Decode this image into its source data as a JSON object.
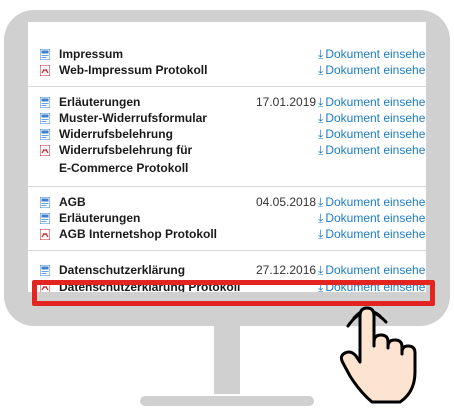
{
  "groups": [
    {
      "items": [
        {
          "icon": "web-doc-icon",
          "title": "Impressum",
          "date": "",
          "link": "Dokument einsehen"
        },
        {
          "icon": "pdf-icon",
          "title": "Web-Impressum Protokoll",
          "date": "",
          "link": "Dokument einsehen"
        }
      ]
    },
    {
      "items": [
        {
          "icon": "web-doc-icon",
          "title": "Erläuterungen",
          "date": "17.01.2019",
          "link": "Dokument einsehen"
        },
        {
          "icon": "web-doc-icon",
          "title": "Muster-Widerrufsformular",
          "date": "",
          "link": "Dokument einsehen"
        },
        {
          "icon": "web-doc-icon",
          "title": "Widerrufsbelehrung",
          "date": "",
          "link": "Dokument einsehen"
        },
        {
          "icon": "pdf-icon",
          "title": "Widerrufsbelehrung für",
          "title_line2": "E-Commerce Protokoll",
          "date": "",
          "link": "Dokument einsehen"
        }
      ]
    },
    {
      "items": [
        {
          "icon": "web-doc-icon",
          "title": "AGB",
          "date": "04.05.2018",
          "link": "Dokument einsehen"
        },
        {
          "icon": "web-doc-icon",
          "title": "Erläuterungen",
          "date": "",
          "link": "Dokument einsehen"
        },
        {
          "icon": "pdf-icon",
          "title": "AGB Internetshop Protokoll",
          "date": "",
          "link": "Dokument einsehen"
        }
      ]
    },
    {
      "items": [
        {
          "icon": "web-doc-icon",
          "title": "Datenschutzerklärung",
          "date": "27.12.2016",
          "link": "Dokument einsehen"
        },
        {
          "icon": "pdf-icon",
          "title": "Datenschutzerklärung Protokoll",
          "date": "",
          "link": "Dokument einsehen"
        }
      ]
    }
  ],
  "download_glyph": "⤓",
  "colors": {
    "link": "#1c7cc7",
    "highlight": "#e42420",
    "pdf": "#c8202a",
    "web_doc": "#3a7fd0"
  }
}
